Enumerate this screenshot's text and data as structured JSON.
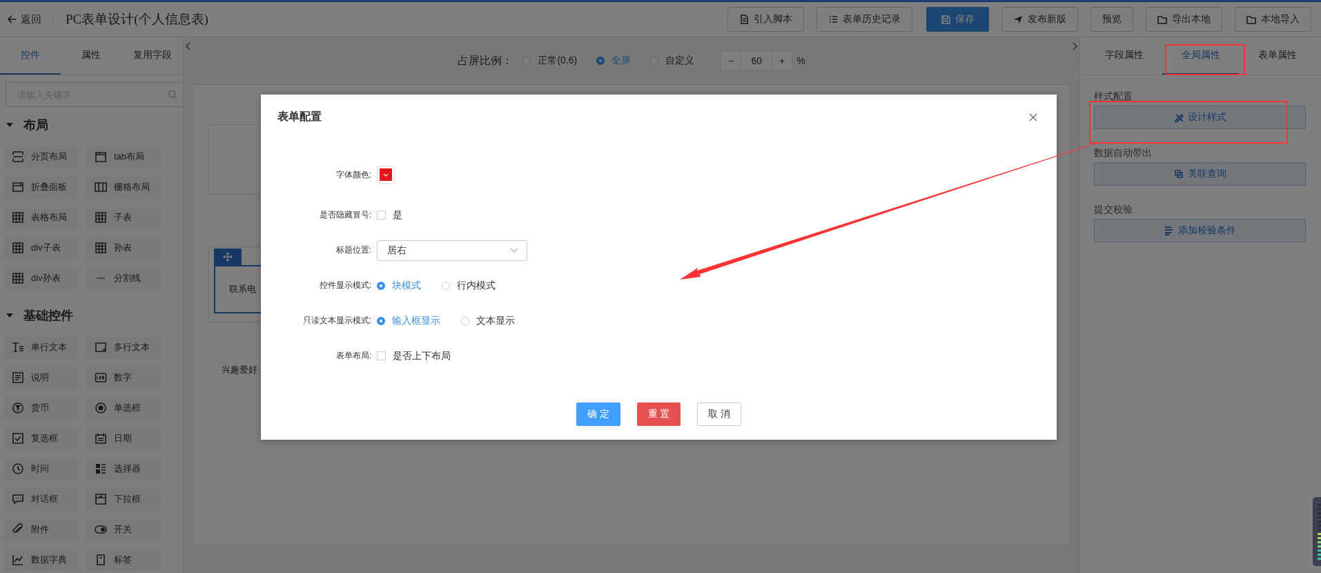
{
  "top_bar": {
    "back": "返回",
    "title": "PC表单设计(个人信息表)",
    "buttons": [
      {
        "label": "引入脚本",
        "kind": "script"
      },
      {
        "label": "表单历史记录",
        "kind": "history"
      },
      {
        "label": "保存",
        "kind": "save"
      },
      {
        "label": "发布新版",
        "kind": "publish"
      },
      {
        "label": "预览",
        "kind": "preview"
      },
      {
        "label": "导出本地",
        "kind": "export"
      },
      {
        "label": "本地导入",
        "kind": "import"
      }
    ]
  },
  "left_panel": {
    "tabs": [
      {
        "label": "控件",
        "selected": true
      },
      {
        "label": "属性",
        "selected": false
      },
      {
        "label": "复用字段",
        "selected": false
      }
    ],
    "search": {
      "placeholder": "请输入关键字"
    },
    "groups": [
      {
        "title": "布局",
        "expanded": true,
        "items": [
          {
            "label": "分页布局",
            "kind": "pages"
          },
          {
            "label": "tab布局",
            "kind": "tab"
          },
          {
            "label": "折叠面板",
            "kind": "collapse"
          },
          {
            "label": "栅格布局",
            "kind": "columns"
          },
          {
            "label": "表格布局",
            "kind": "grid"
          },
          {
            "label": "子表",
            "kind": "grid"
          },
          {
            "label": "div子表",
            "kind": "grid"
          },
          {
            "label": "孙表",
            "kind": "grid"
          },
          {
            "label": "div孙表",
            "kind": "grid"
          },
          {
            "label": "分割线",
            "kind": "line"
          }
        ]
      },
      {
        "title": "基础控件",
        "expanded": true,
        "items": [
          {
            "label": "单行文本",
            "kind": "text"
          },
          {
            "label": "多行文本",
            "kind": "textarea"
          },
          {
            "label": "说明",
            "kind": "doc"
          },
          {
            "label": "数字",
            "kind": "number"
          },
          {
            "label": "货币",
            "kind": "currency"
          },
          {
            "label": "单选框",
            "kind": "radio"
          },
          {
            "label": "复选框",
            "kind": "checkbox"
          },
          {
            "label": "日期",
            "kind": "calendar"
          },
          {
            "label": "时间",
            "kind": "clock"
          },
          {
            "label": "选择器",
            "kind": "selector"
          },
          {
            "label": "对话框",
            "kind": "chat"
          },
          {
            "label": "下拉框",
            "kind": "dropdown"
          },
          {
            "label": "附件",
            "kind": "clip"
          },
          {
            "label": "开关",
            "kind": "switch"
          },
          {
            "label": "数据字典",
            "kind": "chart"
          },
          {
            "label": "标签",
            "kind": "tag"
          }
        ]
      }
    ]
  },
  "canvas": {
    "ratio_label": "占屏比例：",
    "ratio_options": [
      {
        "label": "正常(0.6)",
        "selected": false
      },
      {
        "label": "全屏",
        "selected": true
      },
      {
        "label": "自定义",
        "selected": false
      }
    ],
    "zoom": {
      "minus": "−",
      "value": "60",
      "plus": "+",
      "unit": "%"
    },
    "fields": [
      {
        "label": "联系电",
        "selected": true
      },
      {
        "label": "兴趣爱好",
        "selected": false
      }
    ]
  },
  "right_panel": {
    "tabs": [
      {
        "label": "字段属性",
        "selected": false
      },
      {
        "label": "全局属性",
        "selected": true
      },
      {
        "label": "表单属性",
        "selected": false
      }
    ],
    "sections": [
      {
        "title": "样式配置",
        "button": "设计样式",
        "kind": "design"
      },
      {
        "title": "数据自动带出",
        "button": "关联查询",
        "kind": "link"
      },
      {
        "title": "提交校验",
        "button": "添加校验条件",
        "kind": "rules"
      }
    ]
  },
  "dialog": {
    "title": "表单配置",
    "fields": [
      {
        "label": "字体颜色:",
        "kind": "color",
        "color": "#e3161c"
      },
      {
        "label": "是否隐藏冒号:",
        "kind": "checkbox",
        "option": "是",
        "checked": false
      },
      {
        "label": "标题位置:",
        "kind": "select",
        "value": "居右"
      },
      {
        "label": "控件显示模式:",
        "kind": "radio",
        "options": [
          {
            "label": "块模式",
            "selected": true
          },
          {
            "label": "行内模式",
            "selected": false
          }
        ]
      },
      {
        "label": "只读文本显示模式:",
        "kind": "radio",
        "options": [
          {
            "label": "输入框显示",
            "selected": true
          },
          {
            "label": "文本显示",
            "selected": false
          }
        ]
      },
      {
        "label": "表单布局:",
        "kind": "checkbox",
        "option": "是否上下布局",
        "checked": false
      }
    ],
    "buttons": [
      {
        "label": "确 定",
        "kind": "primary"
      },
      {
        "label": "重 置",
        "kind": "danger"
      },
      {
        "label": "取 消",
        "kind": "default"
      }
    ]
  }
}
